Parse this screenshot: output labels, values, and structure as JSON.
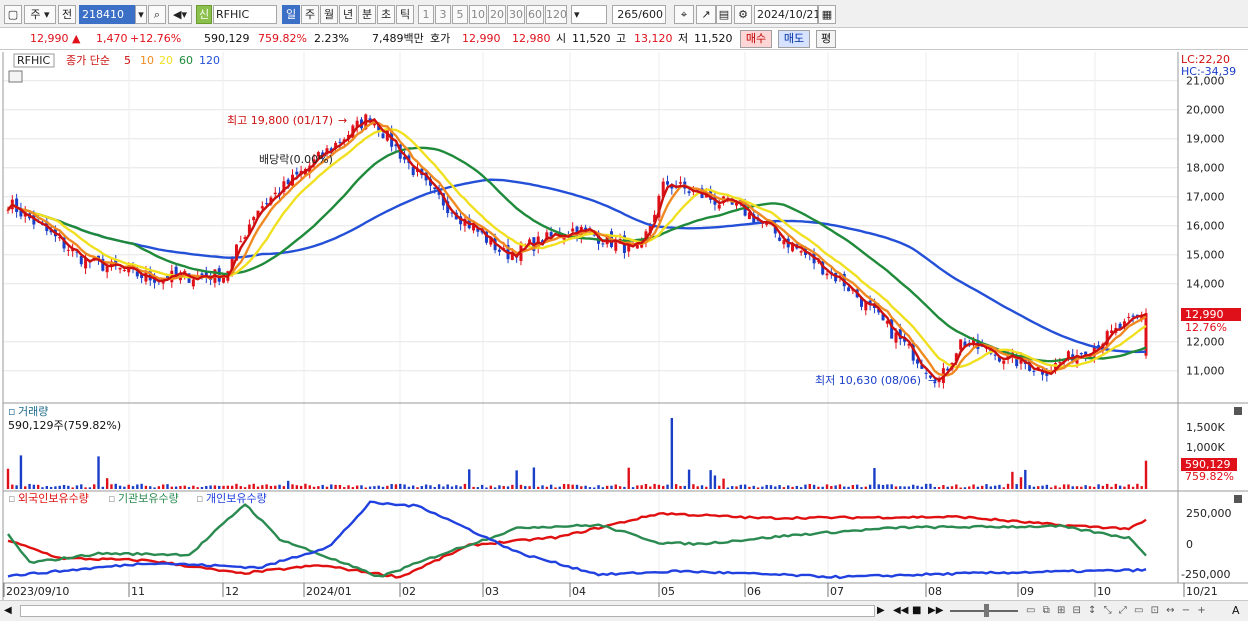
{
  "toolbar": {
    "market": "주",
    "scope": "전",
    "code": "218410",
    "badge": "신",
    "name": "RFHIC",
    "periods": [
      "일",
      "주",
      "월",
      "년",
      "분",
      "초",
      "틱"
    ],
    "active_period": "일",
    "nums": [
      "1",
      "3",
      "5",
      "10",
      "20",
      "30",
      "60",
      "120"
    ],
    "count": "265",
    "count_total": "/600",
    "date": "2024/10/21"
  },
  "quote": {
    "price": "12,990",
    "change": "1,470",
    "change_pct": "+12.76%",
    "volume": "590,129",
    "vol_ratio": "759.82%",
    "turnover": "2.23%",
    "trade_value": "7,489백만",
    "bid_label": "호가",
    "ask": "12,990",
    "bid": "12,980",
    "open_label": "시",
    "open": "11,520",
    "high_label": "고",
    "high": "13,120",
    "low_label": "저",
    "low": "11,520",
    "buy_label": "매수",
    "sell_label": "매도",
    "flat_label": "평"
  },
  "price_pane": {
    "symbol": "RFHIC",
    "legend_label": "종가 단순",
    "ma_labels": [
      "5",
      "10",
      "20",
      "60",
      "120"
    ],
    "lc": "LC:22,20",
    "hc": "HC:-34,39",
    "y_ticks": [
      "21,000",
      "20,000",
      "19,000",
      "18,000",
      "17,000",
      "16,000",
      "15,000",
      "14,000",
      "12,000",
      "11,000"
    ],
    "high_annotation": "최고 19,800 (01/17)",
    "low_annotation": "최저 10,630 (08/06)",
    "dividend_label": "배당락(0.00%)",
    "last_price_tag": "12,990",
    "last_change_tag": "12.76%"
  },
  "volume_pane": {
    "title": "거래량",
    "info": "590,129주(759.82%)",
    "y_ticks": [
      "1,500K",
      "1,000K"
    ],
    "last_volume_tag": "590,129",
    "last_ratio_tag": "759.82%"
  },
  "holdings_pane": {
    "series_labels": [
      "외국인보유수량",
      "기관보유수량",
      "개인보유수량"
    ],
    "y_ticks": [
      "250,000",
      "0",
      "-250,000"
    ]
  },
  "x_axis": {
    "labels": [
      "2023/09/10",
      "11",
      "12",
      "2024/01",
      "02",
      "03",
      "04",
      "05",
      "06",
      "07",
      "08",
      "09",
      "10",
      "10/21"
    ]
  },
  "colors": {
    "up": "#e0101a",
    "down": "#1a3ec8",
    "ma5": "#cc1010",
    "ma10": "#f08a20",
    "ma20": "#f0e020",
    "ma60": "#1f8a3a",
    "ma120": "#2450d8",
    "foreign": "#e01010",
    "institution": "#2a8a50",
    "individual": "#2040e0"
  },
  "chart_data": {
    "type": "candlestick",
    "unit": "KRW",
    "x_start": "2023/09",
    "x_end": "2024/10/21",
    "ylim": [
      10500,
      21500
    ],
    "close_samples": [
      {
        "x": "2023/09",
        "y": 16800
      },
      {
        "x": "2023/10",
        "y": 14800
      },
      {
        "x": "2023/11",
        "y": 14200
      },
      {
        "x": "2023/12",
        "y": 14300
      },
      {
        "x": "2023/12 end",
        "y": 16500
      },
      {
        "x": "2024/01/17",
        "y": 19800
      },
      {
        "x": "2024/02",
        "y": 17200
      },
      {
        "x": "2024/03",
        "y": 15000
      },
      {
        "x": "2024/04",
        "y": 15900
      },
      {
        "x": "2024/04 end",
        "y": 15100
      },
      {
        "x": "2024/05",
        "y": 17500
      },
      {
        "x": "2024/06",
        "y": 16500
      },
      {
        "x": "2024/07",
        "y": 14000
      },
      {
        "x": "2024/08/06",
        "y": 10630
      },
      {
        "x": "2024/08",
        "y": 12000
      },
      {
        "x": "2024/09",
        "y": 11000
      },
      {
        "x": "2024/10",
        "y": 12000
      },
      {
        "x": "2024/10/21",
        "y": 12990
      }
    ]
  }
}
